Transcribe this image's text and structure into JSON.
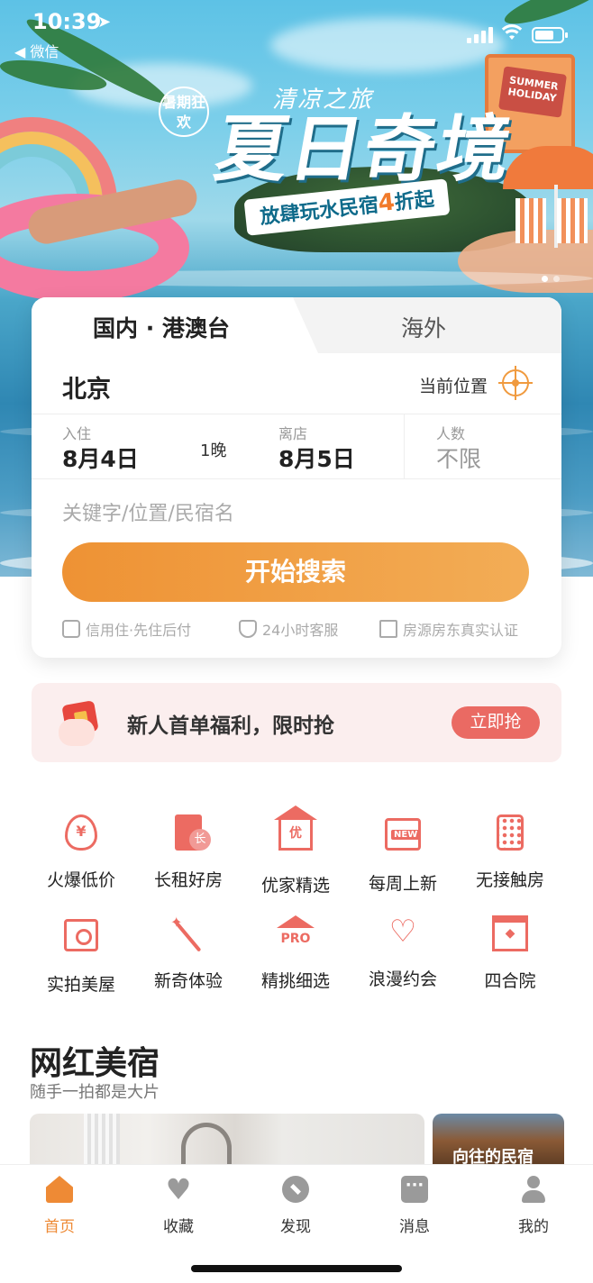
{
  "status_bar": {
    "time": "10:39",
    "location_arrow": "➤",
    "back_app": "◀ 微信"
  },
  "banner": {
    "badge": "暑期狂欢",
    "subtitle": "清凉之旅",
    "title": "夏日奇境",
    "ribbon_before": "放肆玩水民宿",
    "ribbon_highlight": "4",
    "ribbon_after": "折起",
    "sign": "SUMMER HOLIDAY",
    "carousel_dots": 2,
    "carousel_active": 1
  },
  "search": {
    "tabs": [
      "国内 · 港澳台",
      "海外"
    ],
    "active_tab": 0,
    "city": "北京",
    "current_location_label": "当前位置",
    "checkin_label": "入住",
    "checkin_value": "8月4日",
    "nights": "1晚",
    "checkout_label": "离店",
    "checkout_value": "8月5日",
    "guests_label": "人数",
    "guests_value": "不限",
    "keyword_placeholder": "关键字/位置/民宿名",
    "search_button": "开始搜索",
    "features": [
      "信用住·先住后付",
      "24小时客服",
      "房源房东真实认证"
    ]
  },
  "newbie": {
    "text": "新人首单福利，限时抢",
    "button": "立即抢"
  },
  "categories": [
    {
      "label": "火爆低价",
      "icon": "flame-yuan-icon"
    },
    {
      "label": "长租好房",
      "icon": "long-term-building-icon"
    },
    {
      "label": "优家精选",
      "icon": "premium-house-icon"
    },
    {
      "label": "每周上新",
      "icon": "new-house-icon"
    },
    {
      "label": "无接触房",
      "icon": "keypad-icon"
    },
    {
      "label": "实拍美屋",
      "icon": "camera-house-icon"
    },
    {
      "label": "新奇体验",
      "icon": "magic-wand-icon"
    },
    {
      "label": "精挑细选",
      "icon": "pro-house-icon"
    },
    {
      "label": "浪漫约会",
      "icon": "heart-balloon-icon"
    },
    {
      "label": "四合院",
      "icon": "courtyard-gate-icon"
    }
  ],
  "section": {
    "title": "网红美宿",
    "subtitle": "随手一拍都是大片",
    "card2_caption": "向往的民宿"
  },
  "tabbar": [
    {
      "label": "首页",
      "icon": "home-icon",
      "active": true
    },
    {
      "label": "收藏",
      "icon": "heart-icon",
      "active": false
    },
    {
      "label": "发现",
      "icon": "compass-icon",
      "active": false
    },
    {
      "label": "消息",
      "icon": "message-icon",
      "active": false
    },
    {
      "label": "我的",
      "icon": "user-icon",
      "active": false
    }
  ],
  "colors": {
    "accent": "#ee8a35",
    "category_icon": "#ec6b62",
    "newbie_bg": "#fbeeee",
    "grab_button": "#ea6a63"
  }
}
